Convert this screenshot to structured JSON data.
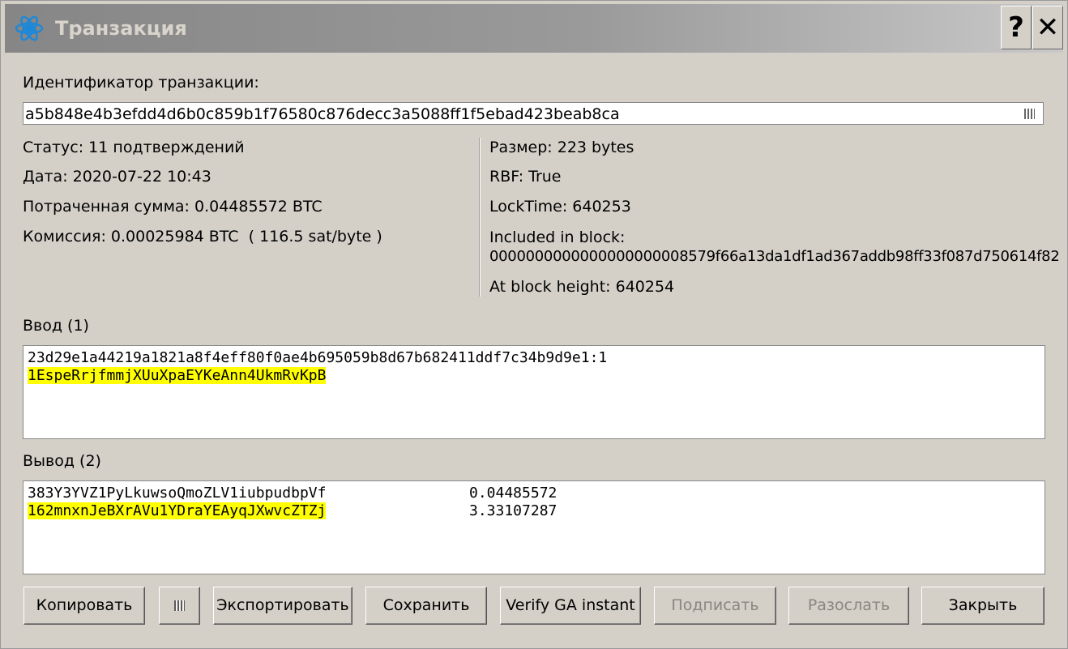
{
  "window": {
    "title": "Транзакция",
    "help_label": "?",
    "close_label": "✕",
    "icon": "electrum-logo-icon"
  },
  "txid": {
    "label": "Идентификатор транзакции:",
    "value": "a5b848e4b3efdd4d6b0c859b1f76580c876decc3a5088ff1f5ebad423beab8ca",
    "icon": "qr-code-icon"
  },
  "info_left": [
    "Статус: 11 подтверждений",
    "Дата: 2020-07-22 10:43",
    "Потраченная сумма: 0.04485572 BTC",
    "Комиссия: 0.00025984 BTC  ( 116.5 sat/byte )"
  ],
  "info_right": {
    "size": "Размер: 223 bytes",
    "rbf": "RBF: True",
    "locktime": "LockTime: 640253",
    "block_label": "Included in block:",
    "block_hash": "0000000000000000000008579f66a13da1df1ad367addb98ff33f087d750614f82",
    "height": "At block height: 640254"
  },
  "inputs": {
    "label": "Ввод (1)",
    "items": [
      {
        "prevout": "23d29e1a44219a1821a8f4eff80f0ae4b695059b8d67b682411ddf7c34b9d9e1:1",
        "address": "1EspeRrjfmmjXUuXpaEYKeAnn4UkmRvKpB"
      }
    ]
  },
  "outputs": {
    "label": "Вывод (2)",
    "items": [
      {
        "address": "383Y3YVZ1PyLkuwsoQmoZLV1iubpudbpVf",
        "amount": "0.04485572"
      },
      {
        "address": "162mnxnJeBXrAVu1YDraYEAyqJXwvcZTZj",
        "amount": "3.33107287"
      }
    ]
  },
  "buttons": {
    "copy": "Копировать",
    "export": "Экспортировать",
    "save": "Сохранить",
    "verify": "Verify GA instant",
    "sign": "Подписать",
    "broadcast": "Разослать",
    "close": "Закрыть"
  },
  "colors": {
    "highlight": "#ffff00",
    "background": "#d4d0c8"
  }
}
